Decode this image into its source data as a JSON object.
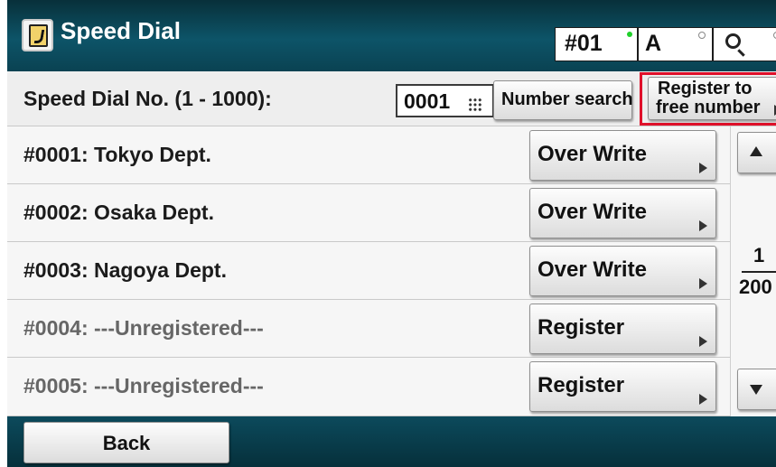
{
  "header": {
    "title": "Speed Dial",
    "status_number": "#01",
    "status_mode": "A",
    "search_icon": "search-icon"
  },
  "number_bar": {
    "label": "Speed Dial No. (1 - 1000):",
    "input_value": "0001",
    "keypad_icon": "keypad-icon",
    "number_search_label": "Number search",
    "register_free_line1": "Register to",
    "register_free_line2": "free number"
  },
  "entries": [
    {
      "label": "#0001: Tokyo Dept.",
      "button": "Over Write",
      "registered": true
    },
    {
      "label": "#0002: Osaka Dept.",
      "button": "Over Write",
      "registered": true
    },
    {
      "label": "#0003: Nagoya Dept.",
      "button": "Over Write",
      "registered": true
    },
    {
      "label": "#0004: ---Unregistered---",
      "button": "Register",
      "registered": false
    },
    {
      "label": "#0005: ---Unregistered---",
      "button": "Register",
      "registered": false
    }
  ],
  "pager": {
    "current": "1",
    "total": "200"
  },
  "footer": {
    "back_label": "Back"
  },
  "colors": {
    "header_bg": "#0d5468",
    "highlight": "#e0102a",
    "active_dot": "#1fd02a"
  }
}
